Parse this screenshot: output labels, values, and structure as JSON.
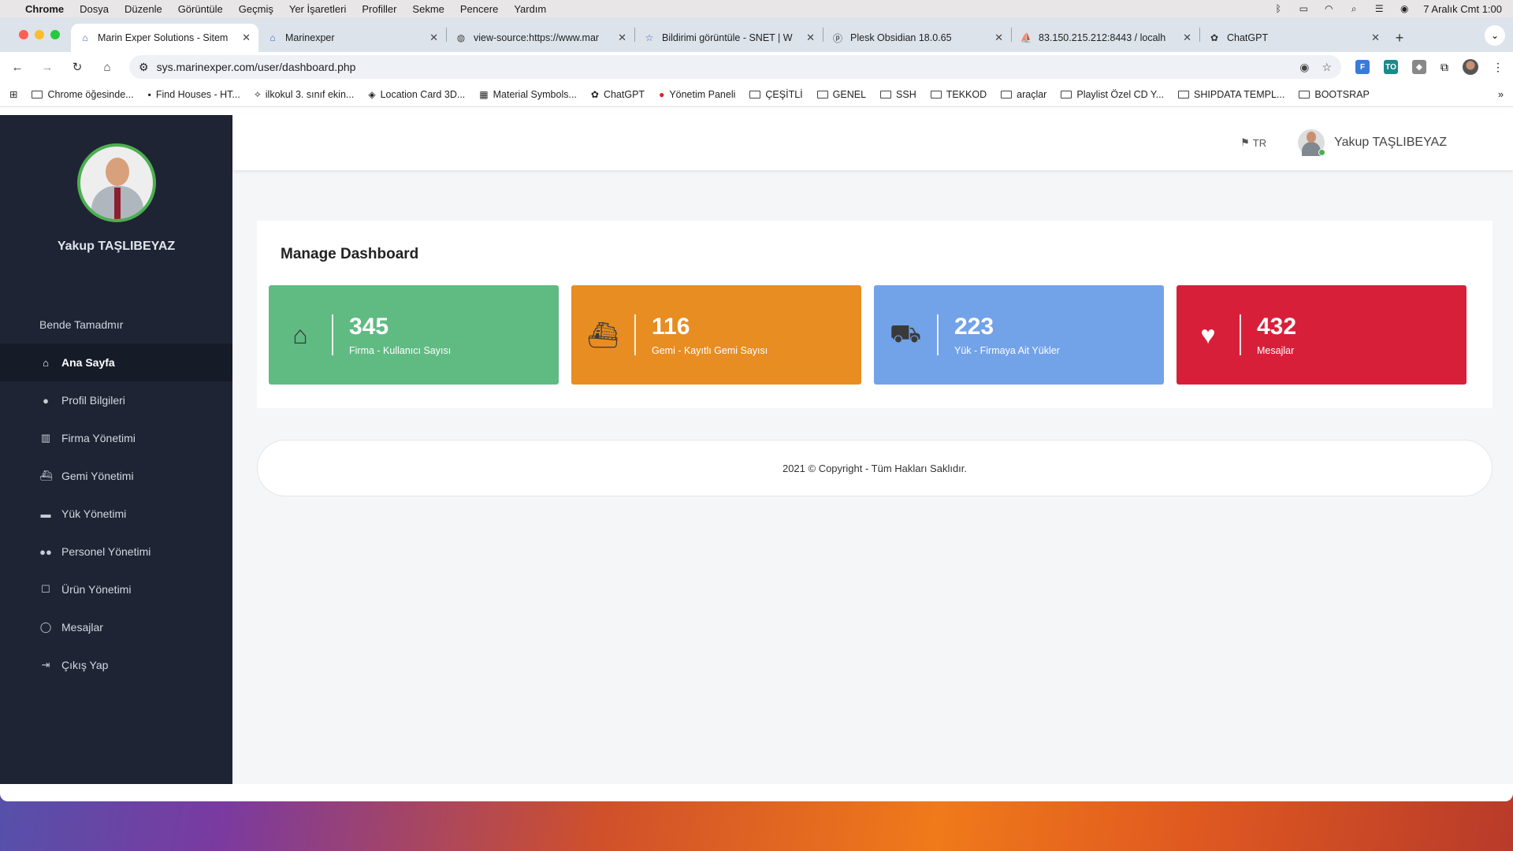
{
  "menubar": {
    "app": "Chrome",
    "items": [
      "Dosya",
      "Düzenle",
      "Görüntüle",
      "Geçmiş",
      "Yer İşaretleri",
      "Profiller",
      "Sekme",
      "Pencere",
      "Yardım"
    ],
    "datetime": "7 Aralık Cmt  1:00"
  },
  "tabs": [
    {
      "title": "Marin Exper Solutions - Sitem",
      "active": true
    },
    {
      "title": "Marinexper"
    },
    {
      "title": "view-source:https://www.mar"
    },
    {
      "title": "Bildirimi görüntüle - SNET | W"
    },
    {
      "title": "Plesk Obsidian 18.0.65"
    },
    {
      "title": "83.150.215.212:8443 / localh"
    },
    {
      "title": "ChatGPT"
    }
  ],
  "address": {
    "url": "sys.marinexper.com/user/dashboard.php"
  },
  "bookmarks": [
    "Chrome öğesinde...",
    "Find Houses - HT...",
    "ilkokul 3. sınıf ekin...",
    "Location Card 3D...",
    "Material Symbols...",
    "ChatGPT",
    "Yönetim Paneli",
    "ÇEŞİTLİ",
    "GENEL",
    "SSH",
    "TEKKOD",
    "araçlar",
    "Playlist Özel CD Y...",
    "SHIPDATA TEMPL...",
    "BOOTSRAP"
  ],
  "sidebar": {
    "user_name": "Yakup TAŞLIBEYAZ",
    "heading": "Bende Tamadmır",
    "items": [
      {
        "label": "Ana Sayfa",
        "icon": "home-icon",
        "active": true
      },
      {
        "label": "Profil Bilgileri",
        "icon": "user-icon"
      },
      {
        "label": "Firma Yönetimi",
        "icon": "building-icon"
      },
      {
        "label": "Gemi Yönetimi",
        "icon": "ship-icon"
      },
      {
        "label": "Yük Yönetimi",
        "icon": "truck-icon"
      },
      {
        "label": "Personel Yönetimi",
        "icon": "users-icon"
      },
      {
        "label": "Ürün Yönetimi",
        "icon": "square-icon"
      },
      {
        "label": "Mesajlar",
        "icon": "comment-icon"
      },
      {
        "label": "Çıkış Yap",
        "icon": "sign-out-icon"
      }
    ]
  },
  "topbar": {
    "lang": "TR",
    "user_name": "Yakup TAŞLIBEYAZ"
  },
  "dashboard": {
    "title": "Manage Dashboard",
    "stats": [
      {
        "value": "345",
        "label": "Firma - Kullanıcı Sayısı",
        "icon": "home-icon",
        "color": "#5fbb82"
      },
      {
        "value": "116",
        "label": "Gemi - Kayıtlı Gemi Sayısı",
        "icon": "ship-icon",
        "color": "#e88d22"
      },
      {
        "value": "223",
        "label": "Yük - Firmaya Ait Yükler",
        "icon": "truck-icon",
        "color": "#72a2e8"
      },
      {
        "value": "432",
        "label": "Mesajlar",
        "icon": "heart-icon",
        "color": "#d81f3a"
      }
    ]
  },
  "footer": {
    "text": "2021 © Copyright - Tüm Hakları Saklıdır."
  }
}
